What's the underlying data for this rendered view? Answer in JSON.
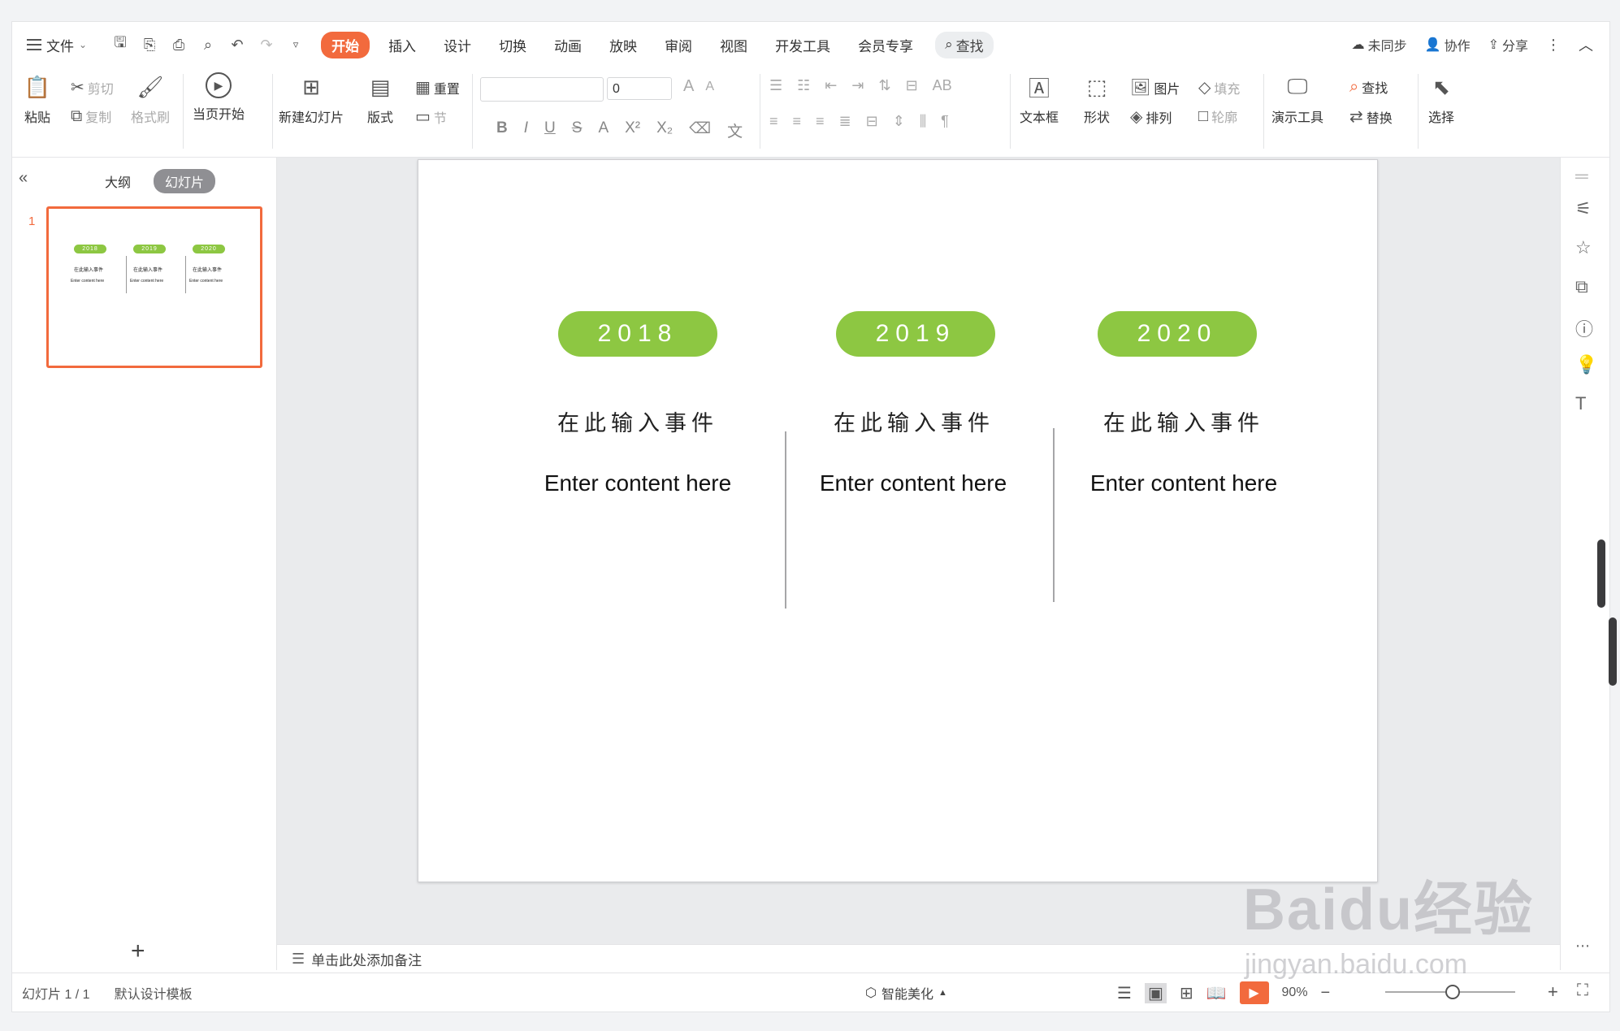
{
  "menu": {
    "file": "文件",
    "tabs": [
      "开始",
      "插入",
      "设计",
      "切换",
      "动画",
      "放映",
      "审阅",
      "视图",
      "开发工具",
      "会员专享"
    ],
    "active_tab": "开始",
    "search": "查找",
    "right": {
      "sync": "未同步",
      "collab": "协作",
      "share": "分享"
    }
  },
  "ribbon": {
    "paste": "粘贴",
    "cut": "剪切",
    "copy": "复制",
    "format_painter": "格式刷",
    "play_current": "当页开始",
    "new_slide": "新建幻灯片",
    "layout": "版式",
    "reset": "重置",
    "section": "节",
    "font_size": "0",
    "textbox": "文本框",
    "shape": "形状",
    "picture": "图片",
    "fill": "填充",
    "arrange": "排列",
    "outline": "轮廓",
    "present_tools": "演示工具",
    "find": "查找",
    "replace": "替换",
    "select": "选择"
  },
  "left_panel": {
    "tab_outline": "大纲",
    "tab_slides": "幻灯片",
    "slide_number": "1"
  },
  "slide": {
    "items": [
      {
        "year": "2018",
        "event": "在此输入事件",
        "content": "Enter content here"
      },
      {
        "year": "2019",
        "event": "在此输入事件",
        "content": "Enter content here"
      },
      {
        "year": "2020",
        "event": "在此输入事件",
        "content": "Enter content here"
      }
    ],
    "accent_color": "#8dc742"
  },
  "notes_placeholder": "单击此处添加备注",
  "status": {
    "slide_count": "幻灯片 1 / 1",
    "template": "默认设计模板",
    "beautify": "智能美化",
    "zoom": "90%"
  },
  "watermark": {
    "brand": "Baidu经验",
    "url": "jingyan.baidu.com"
  }
}
